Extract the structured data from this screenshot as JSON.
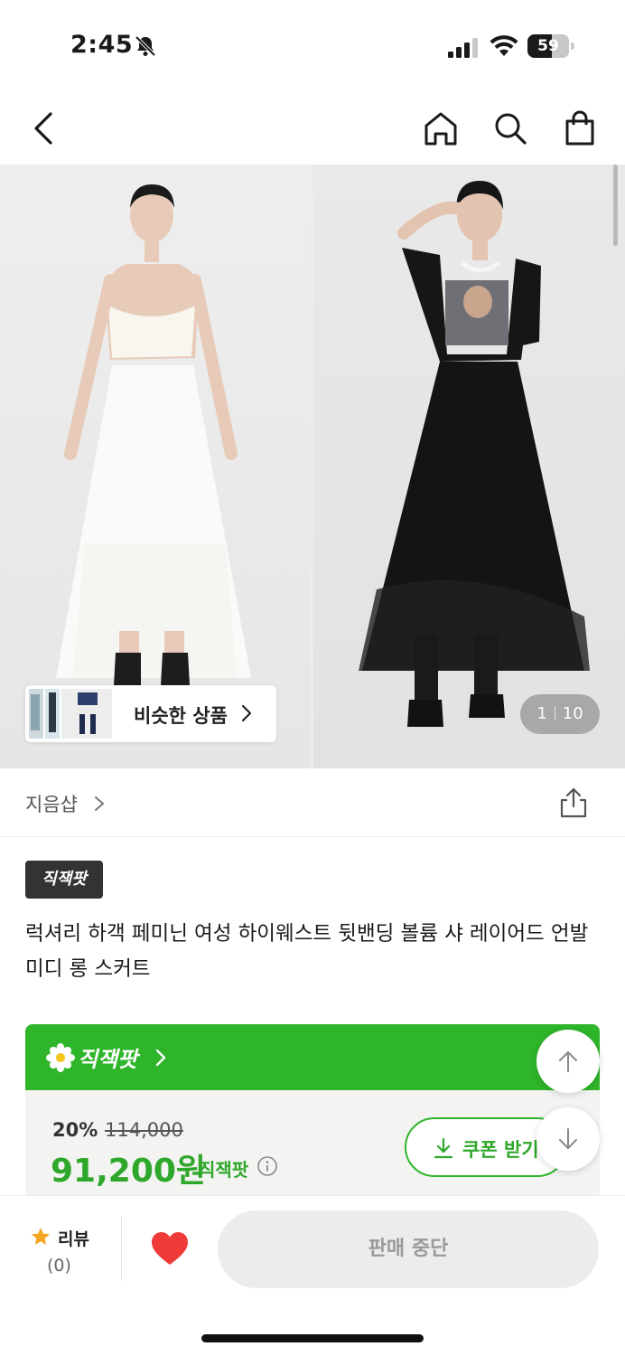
{
  "status_bar": {
    "time": "2:45",
    "battery_level": "59",
    "icons": [
      "bell-off-icon",
      "cellular-signal-icon",
      "wifi-icon",
      "battery-icon"
    ]
  },
  "nav": {
    "icons": [
      "back-arrow-icon",
      "home-icon",
      "search-icon",
      "shopping-bag-icon"
    ]
  },
  "gallery": {
    "current_page": "1",
    "total_pages": "10",
    "similar_products_label": "비슷한 상품"
  },
  "store": {
    "name": "지음샵"
  },
  "product": {
    "badge": "직잭팟",
    "title": "럭셔리 하객 페미닌 여성 하이웨스트 뒷밴딩 볼륨 샤 레이어드 언발 미디 롱 스커트"
  },
  "jackpot_card": {
    "title": "직잭팟",
    "discount_rate": "20%",
    "original_price": "114,000",
    "sale_price": "91,200원",
    "sale_price_label": "직잭팟",
    "coupon_label": "쿠폰 받기"
  },
  "bottom_bar": {
    "review_label": "리뷰",
    "review_count": "(0)",
    "action_label": "판매 중단"
  },
  "colors": {
    "accent_green": "#2fb52a",
    "price_green": "#2fa72a",
    "heart_red": "#f03a3a",
    "star_orange": "#f5a623"
  }
}
